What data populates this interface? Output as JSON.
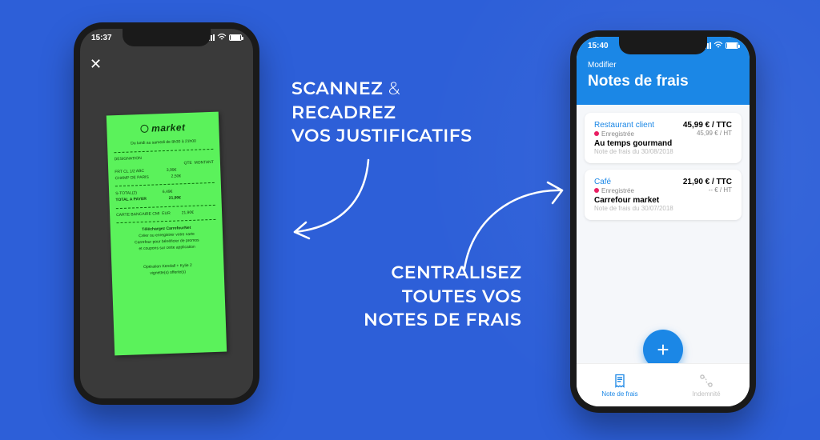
{
  "headline1": {
    "line1_a": "SCANNEZ",
    "line1_b": "&",
    "line2": "RECADREZ",
    "line3": "VOS JUSTIFICATIFS"
  },
  "headline2": {
    "line1": "CENTRALISEZ",
    "line2": "TOUTES VOS",
    "line3": "NOTES DE FRAIS"
  },
  "phoneLeft": {
    "time": "15:37",
    "receipt": {
      "brand": "market",
      "store_hours": "Du lundi au samedi de 8h30 à 21h00",
      "section_label": "DESIGNATION",
      "qty_label": "QTE  MONTANT",
      "item1": "FRT CL 1/2 ABC                    3,99€",
      "item2": "CHAMP DE PARIS                    2,50€",
      "subtotal_label": "S-TOTAL(2)                       6,49€",
      "total_label": "TOTAL A PAYER                    21,90€",
      "pay_line": "CARTE BANCAIRE CMI  EUR          21,90€",
      "promo_title": "Téléchargez CarrefourNet",
      "promo_l1": "Créer ou enregistrer votre carte",
      "promo_l2": "Carrefour pour bénéficier de promos",
      "promo_l3": "et coupons sur cette application",
      "footer_l1": "Opération Kendall + Kylie 2",
      "footer_l2": "vignette(s) offerte(s)"
    }
  },
  "phoneRight": {
    "time": "15:40",
    "header": {
      "modify": "Modifier",
      "title": "Notes de frais"
    },
    "cards": [
      {
        "category": "Restaurant client",
        "price_ttc": "45,99 € / TTC",
        "status": "Enregistrée",
        "price_ht": "45,99 € / HT",
        "vendor": "Au temps gourmand",
        "date": "Note de frais du 30/08/2018"
      },
      {
        "category": "Café",
        "price_ttc": "21,90 € / TTC",
        "status": "Enregistrée",
        "price_ht": "-- € / HT",
        "vendor": "Carrefour market",
        "date": "Note de frais du 30/07/2018"
      }
    ],
    "tabs": {
      "left": "Note de frais",
      "right": "Indemnité"
    }
  }
}
